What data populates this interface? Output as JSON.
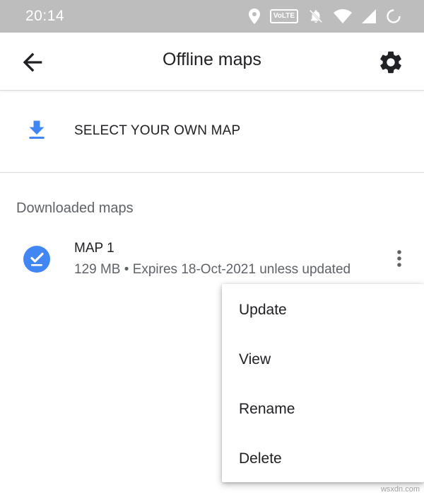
{
  "status_bar": {
    "time": "20:14",
    "volte_label": "VoLTE",
    "icons": [
      "location-icon",
      "volte-icon",
      "do-not-disturb-icon",
      "wifi-icon",
      "signal-icon",
      "battery-icon"
    ]
  },
  "app_bar": {
    "title": "Offline maps",
    "back_icon": "arrow-back-icon",
    "settings_icon": "gear-icon"
  },
  "select_own_map": {
    "label": "SELECT YOUR OWN MAP",
    "icon": "download-icon"
  },
  "downloaded_section": {
    "header": "Downloaded maps",
    "items": [
      {
        "name": "MAP 1",
        "details": "129 MB • Expires 18-Oct-2021 unless updated",
        "icon": "check-circle-icon"
      }
    ]
  },
  "popup_menu": {
    "items": [
      {
        "label": "Update"
      },
      {
        "label": "View"
      },
      {
        "label": "Rename"
      },
      {
        "label": "Delete"
      }
    ]
  },
  "watermark": "wsxdn.com",
  "colors": {
    "status_bar_bg": "#bdbdbd",
    "accent_blue": "#4285f4",
    "primary_text": "#202124",
    "secondary_text": "#5f6368"
  }
}
